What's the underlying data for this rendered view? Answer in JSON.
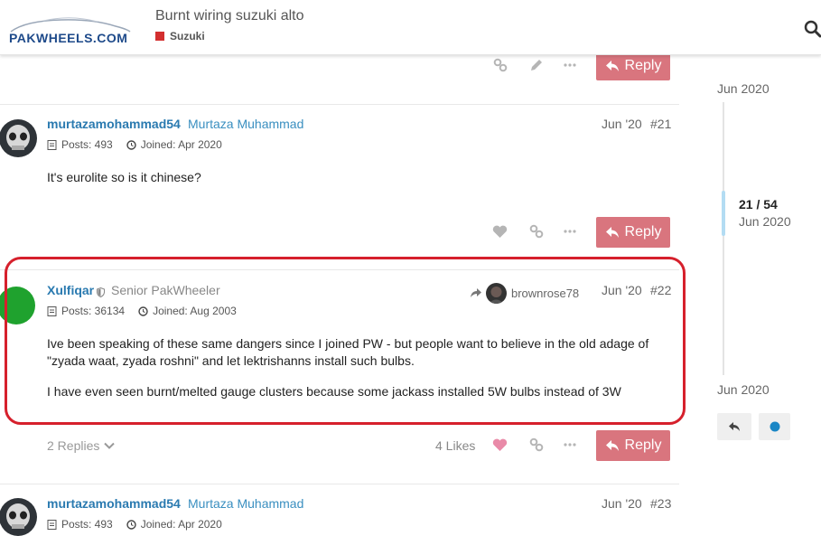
{
  "header": {
    "logo_text": "PAKWHEELS.COM",
    "topic_title": "Burnt wiring suzuki alto",
    "category": "Suzuki",
    "category_color": "#d32f2f"
  },
  "actions": {
    "reply_label": "Reply"
  },
  "timeline": {
    "top_date": "Jun 2020",
    "position": "21 / 54",
    "position_date": "Jun 2020",
    "bottom_date": "Jun 2020"
  },
  "posts": [
    {
      "username": "murtazamohammad54",
      "fullname": "Murtaza Muhammad",
      "posts": "Posts: 493",
      "joined": "Joined: Apr 2020",
      "date": "Jun '20",
      "number": "#21",
      "body": [
        "It's eurolite so is it chinese?"
      ]
    },
    {
      "username": "Xulfiqar",
      "title": "Senior PakWheeler",
      "reply_to": "brownrose78",
      "posts": "Posts: 36134",
      "joined": "Joined: Aug 2003",
      "date": "Jun '20",
      "number": "#22",
      "body": [
        "Ive been speaking of these same dangers since I joined PW - but people want to believe in the old adage of",
        "\"zyada waat, zyada roshni\" and let lektrishanns install such bulbs.",
        "I have even seen burnt/melted gauge clusters because some jackass installed 5W bulbs instead of 3W"
      ],
      "replies": "2 Replies",
      "likes": "4 Likes"
    },
    {
      "username": "murtazamohammad54",
      "fullname": "Murtaza Muhammad",
      "posts": "Posts: 493",
      "joined": "Joined: Apr 2020",
      "date": "Jun '20",
      "number": "#23"
    }
  ],
  "colors": {
    "accent": "#2a7ab0",
    "reply_button": "#d9757e",
    "highlight": "#d6202c",
    "liked_heart": "#e98aa8"
  }
}
